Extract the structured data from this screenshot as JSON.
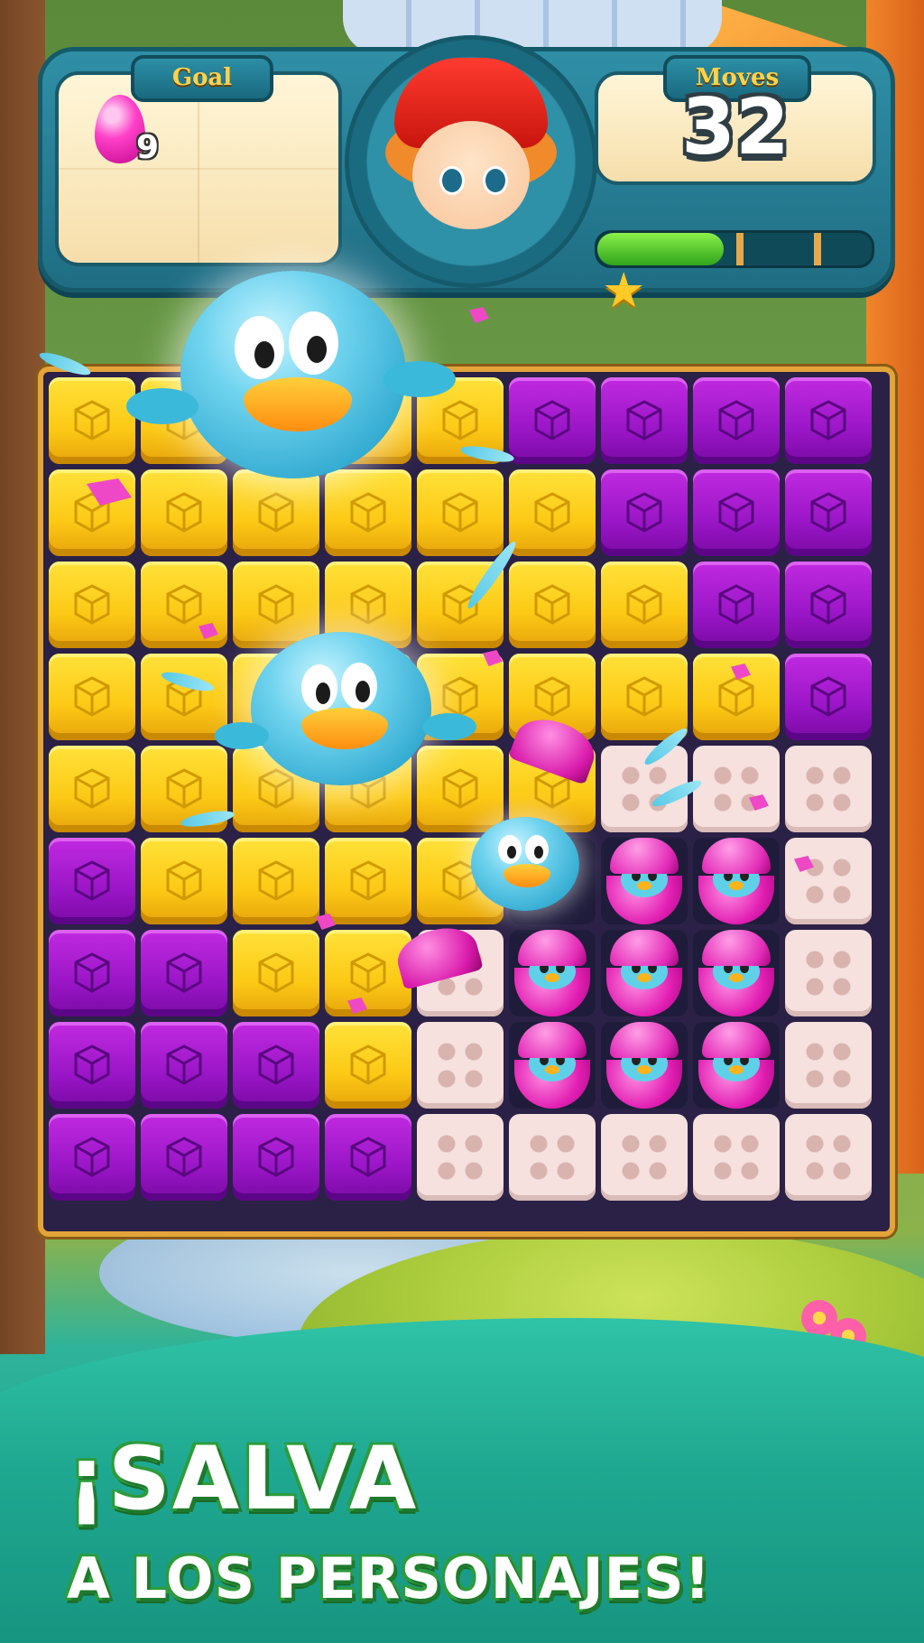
{
  "hud": {
    "goal_label": "Goal",
    "goal_item": "pink-egg-icon",
    "goal_count": "9",
    "moves_label": "Moves",
    "moves_value": "32",
    "progress": 0.46
  },
  "board": {
    "columns": 9,
    "rows": 9,
    "grid": [
      [
        "Y",
        "Y",
        "Y",
        "Y",
        "Y",
        "P",
        "P",
        "P",
        "P"
      ],
      [
        "Y",
        "Y",
        "Y",
        "Y",
        "Y",
        "Y",
        "P",
        "P",
        "P"
      ],
      [
        "Y",
        "Y",
        "Y",
        "Y",
        "Y",
        "Y",
        "Y",
        "P",
        "P"
      ],
      [
        "Y",
        "Y",
        "Y",
        "Y",
        "Y",
        "Y",
        "Y",
        "Y",
        "P"
      ],
      [
        "Y",
        "Y",
        "Y",
        "Y",
        "Y",
        "Y",
        "B",
        "B",
        "B"
      ],
      [
        "P",
        "Y",
        "Y",
        "Y",
        "Y",
        "D",
        "E",
        "E",
        "B"
      ],
      [
        "P",
        "P",
        "Y",
        "Y",
        "B",
        "E",
        "E",
        "E",
        "B"
      ],
      [
        "P",
        "P",
        "P",
        "Y",
        "B",
        "E",
        "E",
        "E",
        "B"
      ],
      [
        "P",
        "P",
        "P",
        "P",
        "B",
        "B",
        "B",
        "B",
        "B"
      ]
    ]
  },
  "colors": {
    "yellow_block": "#fcc915",
    "purple_block": "#9a16c7",
    "brick_block": "#f6e1df",
    "egg": "#e21fb3",
    "banner": "#1fa891"
  },
  "banner": {
    "line1": "¡SALVA",
    "line2": "A LOS PERSONAJES!"
  }
}
